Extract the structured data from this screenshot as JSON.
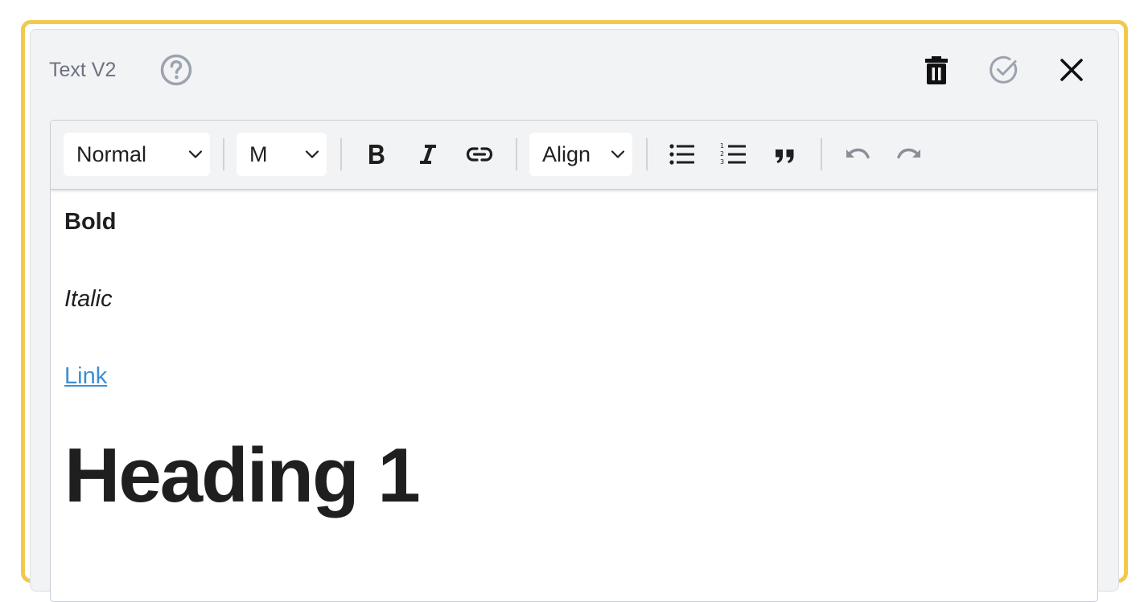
{
  "header": {
    "title": "Text V2",
    "icons": {
      "help": "help-circle-icon",
      "delete": "trash-icon",
      "confirm": "check-circle-icon",
      "close": "close-icon"
    }
  },
  "toolbar": {
    "block_style": "Normal",
    "font_size": "M",
    "align": "Align",
    "buttons": [
      "bold",
      "italic",
      "link",
      "bullet-list",
      "numbered-list",
      "quote",
      "undo",
      "redo"
    ]
  },
  "content": {
    "bold_text": "Bold",
    "italic_text": "Italic",
    "link_text": "Link",
    "heading1": "Heading 1"
  },
  "colors": {
    "frame_border": "#f2c94c",
    "panel_bg": "#f2f3f5",
    "link": "#3b8fd4",
    "icon_muted": "#9ca3af",
    "text": "#1f1f1f"
  }
}
